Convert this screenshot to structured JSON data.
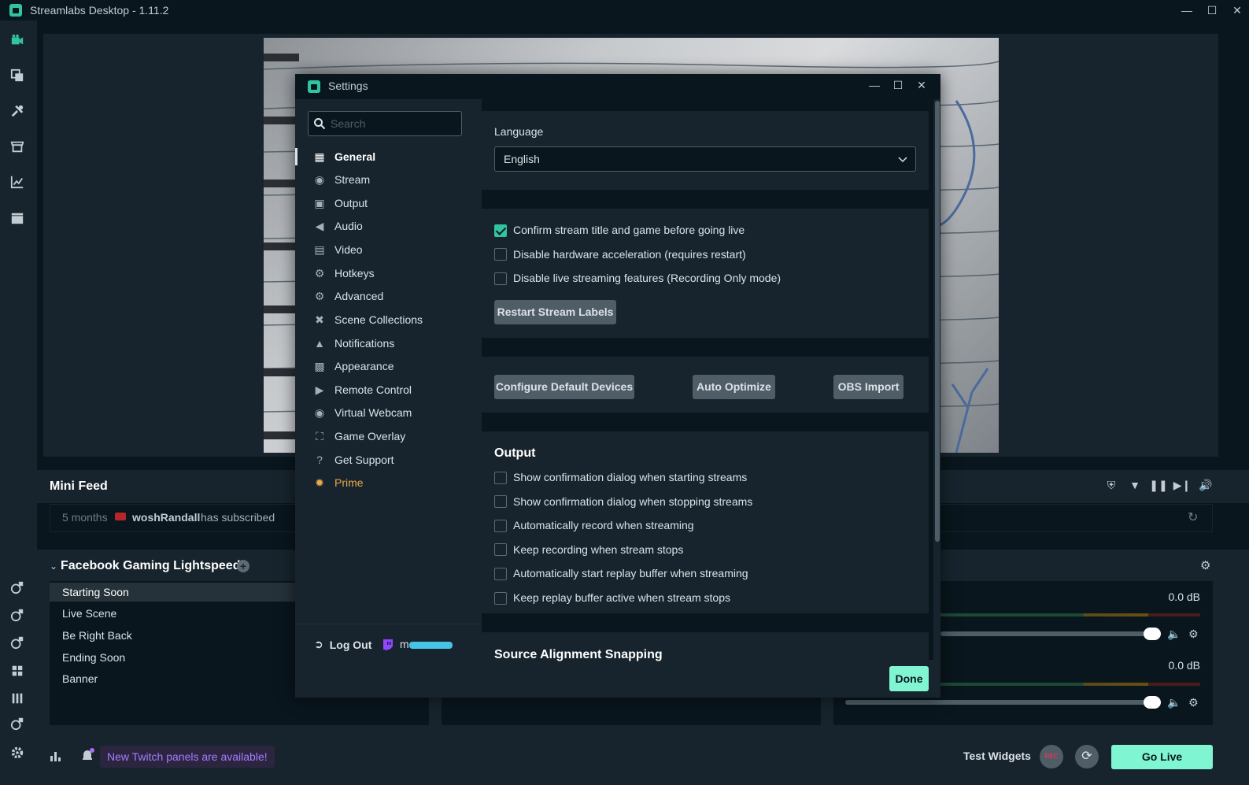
{
  "window": {
    "title": "Streamlabs Desktop - 1.11.2"
  },
  "mini_feed": {
    "title": "Mini Feed",
    "event": {
      "when": "5 months",
      "user": "woshRandall",
      "action": "has subscribed"
    }
  },
  "scene_collection": {
    "title": "Facebook Gaming Lightspeed",
    "scenes": [
      "Starting Soon",
      "Live Scene",
      "Be Right Back",
      "Ending Soon",
      "Banner"
    ],
    "active_index": 0
  },
  "mixer": {
    "levels": [
      "0.0 dB",
      "0.0 dB"
    ]
  },
  "footer": {
    "notice": "New Twitch panels are available!",
    "test_widgets": "Test Widgets",
    "rec_label": "REC",
    "go_live": "Go Live"
  },
  "settings": {
    "title": "Settings",
    "search_placeholder": "Search",
    "nav": [
      {
        "label": "General",
        "icon": "grid-icon"
      },
      {
        "label": "Stream",
        "icon": "globe-icon"
      },
      {
        "label": "Output",
        "icon": "file-icon"
      },
      {
        "label": "Audio",
        "icon": "speaker-icon"
      },
      {
        "label": "Video",
        "icon": "film-icon"
      },
      {
        "label": "Hotkeys",
        "icon": "gear-icon"
      },
      {
        "label": "Advanced",
        "icon": "gears-icon"
      },
      {
        "label": "Scene Collections",
        "icon": "tools-icon"
      },
      {
        "label": "Notifications",
        "icon": "bell-icon"
      },
      {
        "label": "Appearance",
        "icon": "apps-icon"
      },
      {
        "label": "Remote Control",
        "icon": "play-circle-icon"
      },
      {
        "label": "Virtual Webcam",
        "icon": "camera-icon"
      },
      {
        "label": "Game Overlay",
        "icon": "expand-icon"
      },
      {
        "label": "Get Support",
        "icon": "help-icon"
      },
      {
        "label": "Prime",
        "icon": "prime-icon"
      }
    ],
    "active_nav": "General",
    "logout": "Log Out",
    "user_prefix": "m",
    "language": {
      "label": "Language",
      "value": "English"
    },
    "general_checks": [
      {
        "label": "Confirm stream title and game before going live",
        "checked": true
      },
      {
        "label": "Disable hardware acceleration (requires restart)",
        "checked": false
      },
      {
        "label": "Disable live streaming features (Recording Only mode)",
        "checked": false
      }
    ],
    "restart_labels_button": "Restart Stream Labels",
    "device_buttons": [
      "Configure Default Devices",
      "Auto Optimize",
      "OBS Import"
    ],
    "output": {
      "title": "Output",
      "checks": [
        {
          "label": "Show confirmation dialog when starting streams",
          "checked": false
        },
        {
          "label": "Show confirmation dialog when stopping streams",
          "checked": false
        },
        {
          "label": "Automatically record when streaming",
          "checked": false
        },
        {
          "label": "Keep recording when stream stops",
          "checked": false
        },
        {
          "label": "Automatically start replay buffer when streaming",
          "checked": false
        },
        {
          "label": "Keep replay buffer active when stream stops",
          "checked": false
        }
      ]
    },
    "next_section_title": "Source Alignment Snapping",
    "done": "Done"
  },
  "colors": {
    "accent": "#31c3a2",
    "go_live": "#80f5d2",
    "prime": "#e9a74b",
    "notice": "#a67cff",
    "background": "#09161d",
    "panel": "#17242d"
  }
}
